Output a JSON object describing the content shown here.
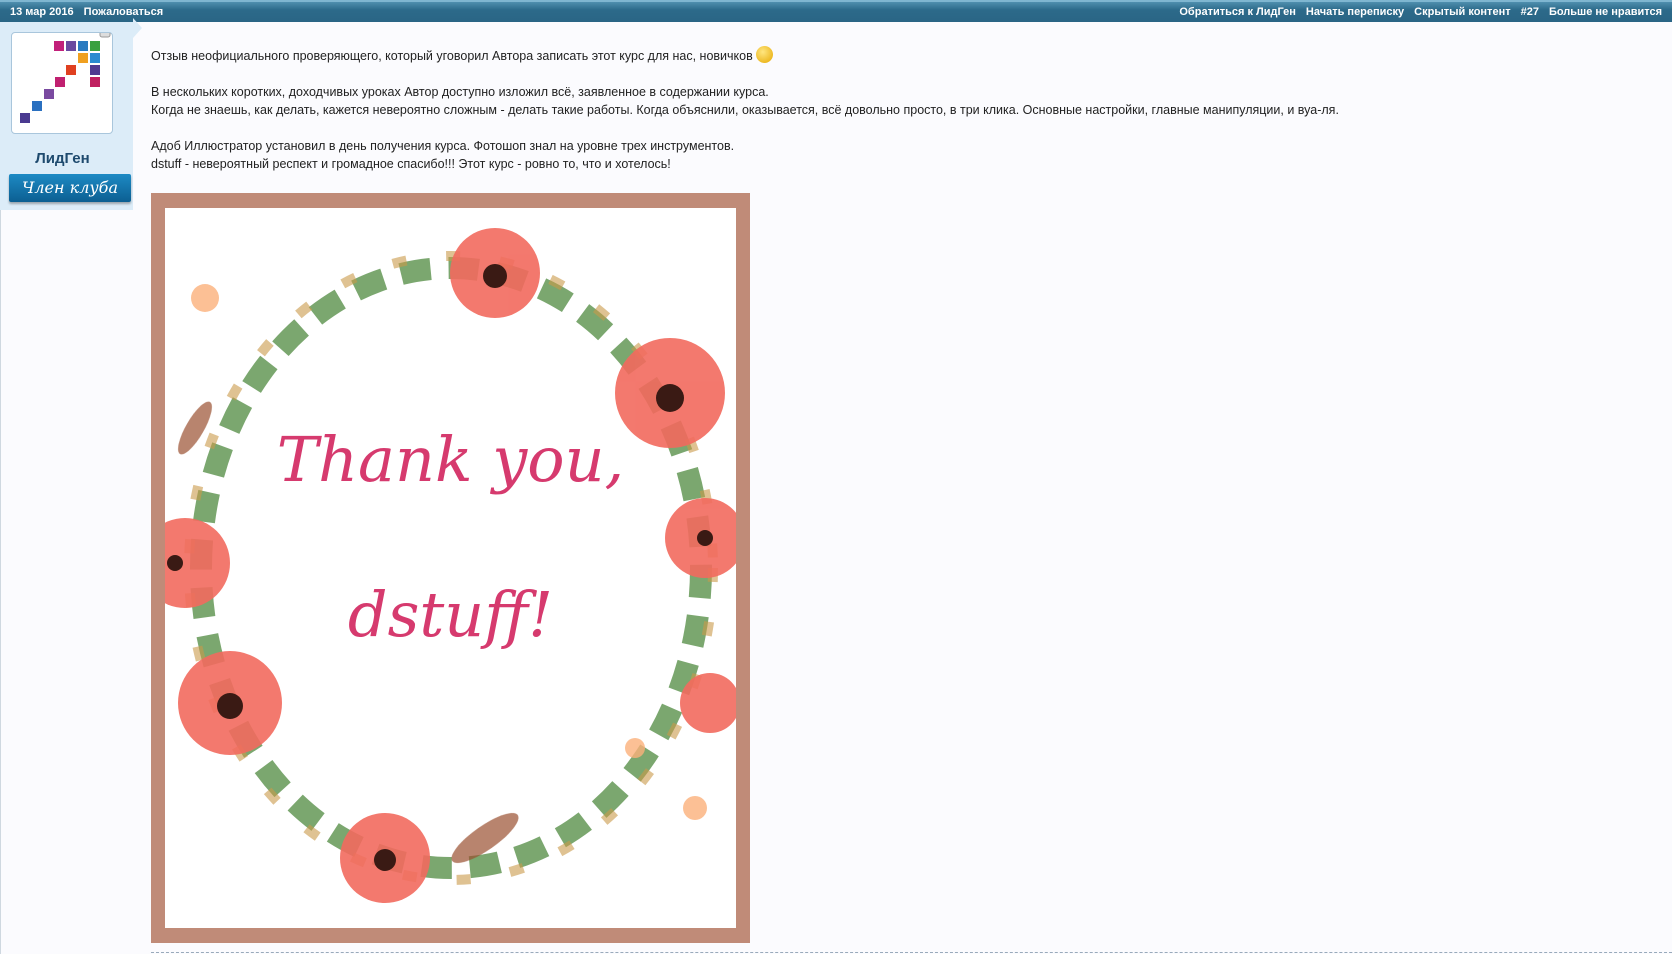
{
  "topbar": {
    "date": "13 мар 2016",
    "report": "Пожаловаться",
    "contact": "Обратиться к ЛидГен",
    "start_conversation": "Начать переписку",
    "hidden_content": "Скрытый контент",
    "post_number": "#27",
    "unlike": "Больше не нравится"
  },
  "author": {
    "name": "ЛидГен",
    "badge": "Член клуба"
  },
  "post": {
    "lines": [
      "Отзыв неофициального проверяющего, который уговорил Автора записать этот курс для нас, новичков",
      "В нескольких коротких, доходчивых уроках Автор доступно изложил всё, заявленное в содержании курса.",
      "Когда не знаешь, как делать, кажется невероятно сложным - делать такие работы. Когда объяснили, оказывается, всё довольно просто, в три клика. Основные настройки, главные манипуляции, и вуа-ля.",
      "Адоб Иллюстратор установил в день получения курса. Фотошоп знал на уровне трех инструментов.",
      "dstuff - невероятный респект и громадное спасибо!!! Этот курс - ровно то, что и хотелось!"
    ]
  },
  "image": {
    "line1": "Thank you,",
    "line2": "dstuff!",
    "frame_color": "#c08b78",
    "text_color": "#d63a6e"
  }
}
